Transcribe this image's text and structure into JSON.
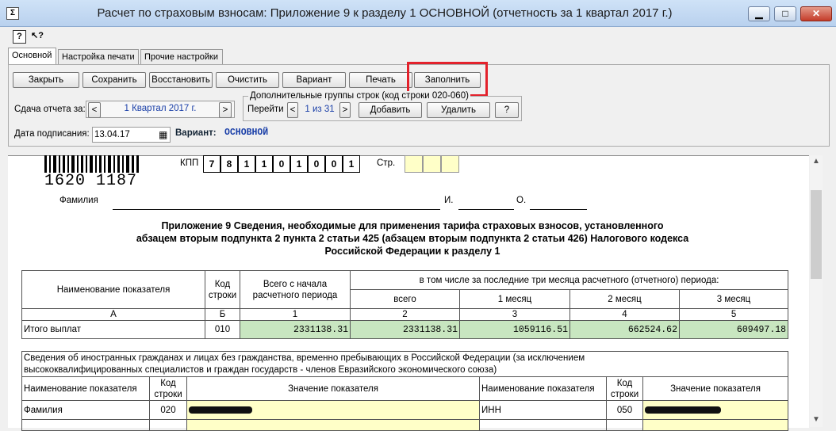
{
  "window": {
    "title": "Расчет по страховым взносам: Приложение 9 к разделу 1 ОСНОВНОЙ (отчетность за 1 квартал 2017 г.)",
    "app_icon": "Σ",
    "min_glyph": "▁",
    "max_glyph": "□",
    "close_glyph": "✕"
  },
  "small_toolbar": {
    "help_icon": "?",
    "whatsthis_icon": "↖?"
  },
  "tabs": [
    {
      "label": "Основной"
    },
    {
      "label": "Настройка печати"
    },
    {
      "label": "Прочие настройки"
    }
  ],
  "toolbar": {
    "close": "Закрыть",
    "save": "Сохранить",
    "restore": "Восстановить",
    "clear": "Очистить",
    "variant": "Вариант",
    "print": "Печать",
    "fill": "Заполнить"
  },
  "period": {
    "label": "Сдача отчета за:",
    "value": "1 Квартал 2017 г.",
    "prev": "<",
    "next": ">"
  },
  "extra_groups": {
    "title": "Дополнительные группы строк (код строки 020-060)",
    "goto": "Перейти",
    "prev": "<",
    "page": "1 из 31",
    "next": ">",
    "add": "Добавить",
    "delete": "Удалить",
    "help": "?"
  },
  "sign_date": {
    "label": "Дата подписания:",
    "value": "13.04.17",
    "calendar_icon": "▦"
  },
  "variant": {
    "label": "Вариант:",
    "value": "ОСНОВНОЙ"
  },
  "document": {
    "barcode_number": "1620 1187",
    "kpp_label": "КПП",
    "kpp_digits": [
      "7",
      "8",
      "1",
      "1",
      "0",
      "1",
      "0",
      "0",
      "1"
    ],
    "page_label": "Стр.",
    "surname_label": "Фамилия",
    "initial_i": "И.",
    "initial_o": "О.",
    "heading_line1": "Приложение 9 Сведения, необходимые для применения тарифа страховых взносов, установленного",
    "heading_line2": "абзацем вторым подпункта 2 пункта 2 статьи 425 (абзацем вторым подпункта 2 статьи 426) Налогового кодекса",
    "heading_line3": "Российской Федерации к разделу 1",
    "table1": {
      "col_name": "Наименование показателя",
      "col_code": "Код строки",
      "col_total": "Всего с начала расчетного периода",
      "col_last3": "в том числе за последние три месяца расчетного (отчетного) периода:",
      "col_all": "всего",
      "col_m1": "1 месяц",
      "col_m2": "2 месяц",
      "col_m3": "3 месяц",
      "idx": [
        "А",
        "Б",
        "1",
        "2",
        "3",
        "4",
        "5"
      ],
      "row": {
        "name": "Итого выплат",
        "code": "010",
        "total": "2331138.31",
        "all": "2331138.31",
        "m1": "1059116.51",
        "m2": "662524.62",
        "m3": "609497.18"
      }
    },
    "table2": {
      "caption_line1": "Сведения об иностранных гражданах и лицах без гражданства, временно пребывающих в Российской Федерации (за исключением",
      "caption_line2": "высококвалифицированных специалистов и граждан государств - членов Евразийского экономического союза)",
      "col_name": "Наименование показателя",
      "col_code": "Код строки",
      "col_value": "Значение показателя",
      "row1_left_name": "Фамилия",
      "row1_left_code": "020",
      "row1_right_name": "ИНН",
      "row1_right_code": "050"
    }
  },
  "colors": {
    "highlight": "#e3212b",
    "input_yellow": "#ffffc8",
    "value_green": "#c8e6c0"
  }
}
